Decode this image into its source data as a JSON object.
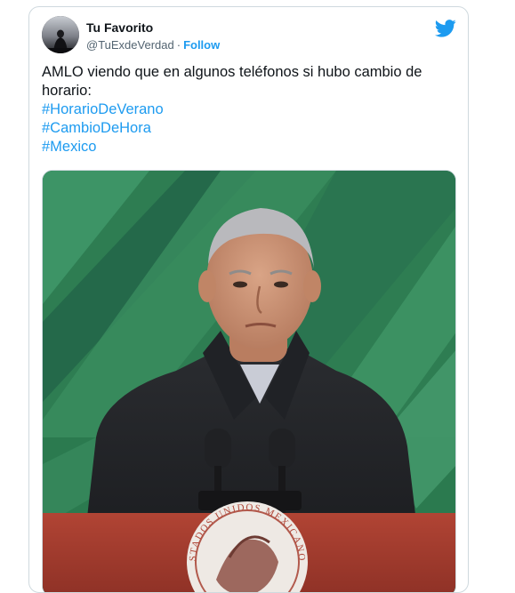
{
  "tweet": {
    "author": {
      "display_name": "Tu Favorito",
      "handle": "@TuExdeVerdad",
      "separator": "·",
      "follow_label": "Follow"
    },
    "text": "AMLO viendo que en algunos teléfonos si hubo cambio de horario:",
    "hashtags": [
      "#HorarioDeVerano",
      "#CambioDeHora",
      "#Mexico"
    ],
    "media": {
      "seal_text": "ESTADOS UNIDOS MEXICANOS"
    }
  },
  "icons": {
    "brand": "twitter-bird-icon"
  },
  "colors": {
    "link": "#1d9bf0",
    "text": "#0f1419",
    "muted": "#536471",
    "border": "#cfd9de",
    "backdrop_green": "#2b7a4f",
    "podium_red": "#a43a2c"
  }
}
